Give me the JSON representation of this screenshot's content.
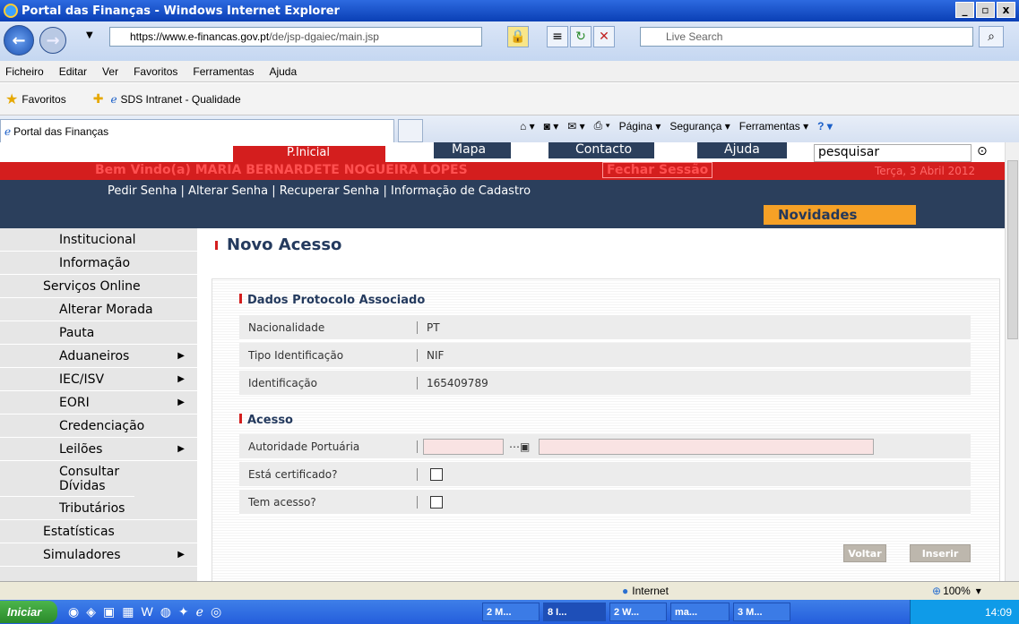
{
  "window": {
    "title": "Portal das Finanças - Windows Internet Explorer",
    "buttons": [
      "_",
      "á",
      "x"
    ]
  },
  "address": {
    "host": "https://www.e-financas.gov.pt",
    "path": "/de/jsp-dgaiec/main.jsp",
    "search_placeholder": "Live Search"
  },
  "menu": [
    "Ficheiro",
    "Editar",
    "Ver",
    "Favoritos",
    "Ferramentas",
    "Ajuda"
  ],
  "favorites": {
    "label": "Favoritos",
    "link": "SDS Intranet - Qualidade"
  },
  "tab": {
    "label": "Portal das Finanças"
  },
  "commands": {
    "pagina": "Página",
    "seguranca": "Segurança",
    "ferramentas": "Ferramentas"
  },
  "site": {
    "top_nav": {
      "inicial": "P.Inicial",
      "mapa": "Mapa",
      "contacto": "Contacto",
      "ajuda": "Ajuda",
      "search": "pesquisar"
    },
    "welcome": "Bem Vindo(a) MARIA BERNARDETE NOGUEIRA LOPES",
    "fechar": "Fechar Sessão",
    "date": "Terça, 3 Abril 2012",
    "links": "Pedir Senha  |  Alterar Senha  |  Recuperar Senha  |  Informação de Cadastro",
    "novidades": "Novidades",
    "sidebar": [
      "Institucional",
      "Informação",
      "Serviços Online",
      "Alterar Morada",
      "Pauta",
      "Aduaneiros",
      "IEC/ISV",
      "EORI",
      "Credenciação",
      "Leilões",
      "Consultar Dívidas",
      "Tributários",
      "Estatísticas",
      "Simuladores"
    ]
  },
  "form": {
    "title": "Novo Acesso",
    "section1": "Dados Protocolo Associado",
    "nacionalidade_label": "Nacionalidade",
    "nacionalidade": "PT",
    "tipo_label": "Tipo Identificação",
    "tipo": "NIF",
    "ident_label": "Identificação",
    "ident": "165409789",
    "section2": "Acesso",
    "autoridade_label": "Autoridade Portuária",
    "certificado_label": "Está certificado?",
    "acesso_label": "Tem acesso?",
    "voltar": "Voltar",
    "inserir": "Inserir"
  },
  "status": {
    "zone": "Internet",
    "zoom": "100%"
  },
  "taskbar": {
    "start": "Iniciar",
    "tasks": [
      "2 M...",
      "8 I...",
      "2 W...",
      "ma...",
      "3 M..."
    ],
    "time": "14:09"
  }
}
